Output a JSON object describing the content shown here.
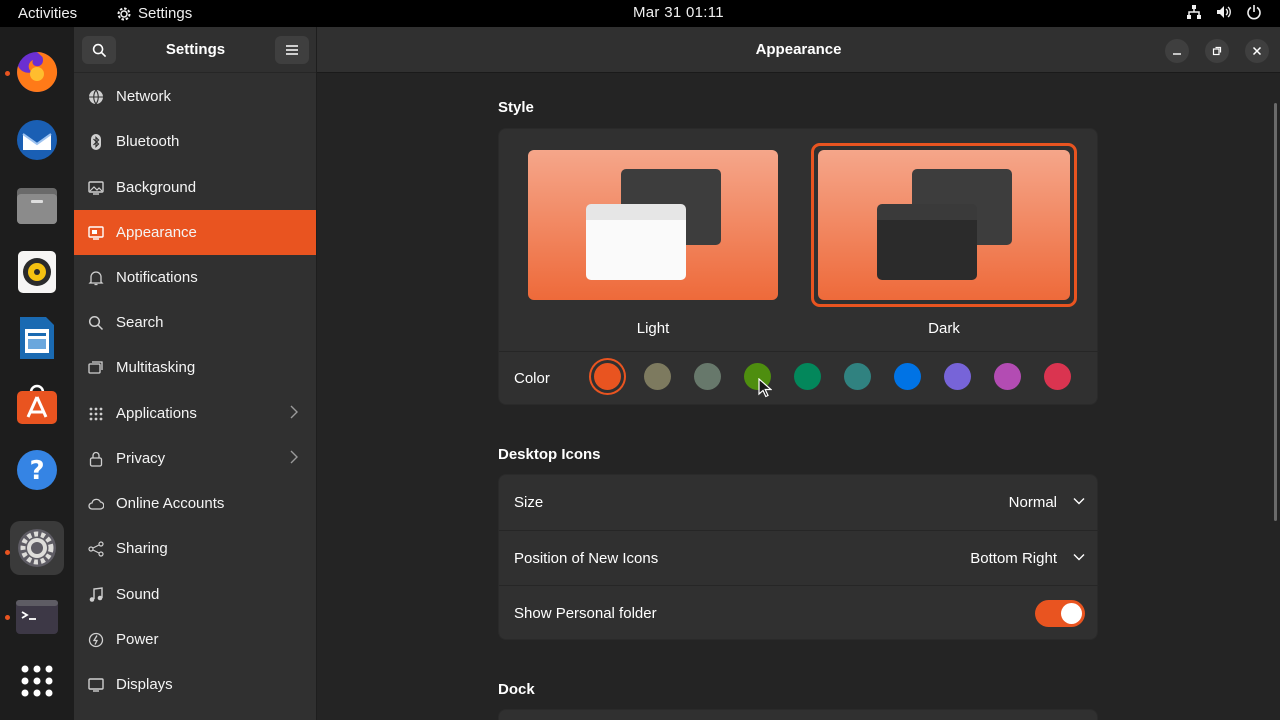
{
  "topbar": {
    "activities": "Activities",
    "app_name": "Settings",
    "clock": "Mar 31  01:11"
  },
  "dock": [
    {
      "name": "Firefox",
      "icon": "firefox-icon",
      "running": true
    },
    {
      "name": "Thunderbird",
      "icon": "thunderbird-icon",
      "running": false
    },
    {
      "name": "Files",
      "icon": "files-icon",
      "running": false
    },
    {
      "name": "Rhythmbox",
      "icon": "rhythmbox-icon",
      "running": false
    },
    {
      "name": "LibreOffice Writer",
      "icon": "writer-icon",
      "running": false
    },
    {
      "name": "Ubuntu Software",
      "icon": "software-icon",
      "running": false
    },
    {
      "name": "Help",
      "icon": "help-icon",
      "running": false
    },
    {
      "name": "Settings",
      "icon": "settings-icon",
      "running": true
    },
    {
      "name": "Terminal",
      "icon": "terminal-icon",
      "running": true
    },
    {
      "name": "Show Applications",
      "icon": "app-grid-icon",
      "running": false
    }
  ],
  "sidebar": {
    "title": "Settings",
    "items": [
      {
        "label": "Network",
        "icon": "network-icon"
      },
      {
        "label": "Bluetooth",
        "icon": "bluetooth-icon"
      },
      {
        "label": "Background",
        "icon": "background-icon"
      },
      {
        "label": "Appearance",
        "icon": "appearance-icon",
        "selected": true
      },
      {
        "label": "Notifications",
        "icon": "bell-icon"
      },
      {
        "label": "Search",
        "icon": "search-icon"
      },
      {
        "label": "Multitasking",
        "icon": "multitasking-icon"
      },
      {
        "label": "Applications",
        "icon": "apps-icon",
        "arrow": true
      },
      {
        "label": "Privacy",
        "icon": "lock-icon",
        "arrow": true
      },
      {
        "label": "Online Accounts",
        "icon": "cloud-icon"
      },
      {
        "label": "Sharing",
        "icon": "share-icon"
      },
      {
        "label": "Sound",
        "icon": "music-note-icon"
      },
      {
        "label": "Power",
        "icon": "power-icon"
      },
      {
        "label": "Displays",
        "icon": "display-icon"
      }
    ]
  },
  "main": {
    "title": "Appearance",
    "style": {
      "heading": "Style",
      "light_label": "Light",
      "dark_label": "Dark",
      "selected": "Dark",
      "color_label": "Color",
      "colors": [
        "#e95420",
        "#7d7a5f",
        "#67786b",
        "#4e8e0f",
        "#03875b",
        "#308280",
        "#0073e5",
        "#7764d8",
        "#b34cb3",
        "#da3450"
      ],
      "selected_color": "#e95420"
    },
    "desktop_icons": {
      "heading": "Desktop Icons",
      "size_label": "Size",
      "size_value": "Normal",
      "position_label": "Position of New Icons",
      "position_value": "Bottom Right",
      "personal_folder_label": "Show Personal folder",
      "personal_folder_on": true
    },
    "dock": {
      "heading": "Dock"
    }
  },
  "colors": {
    "accent": "#e95420",
    "sidebar_bg": "#303030",
    "main_bg": "#242424"
  }
}
